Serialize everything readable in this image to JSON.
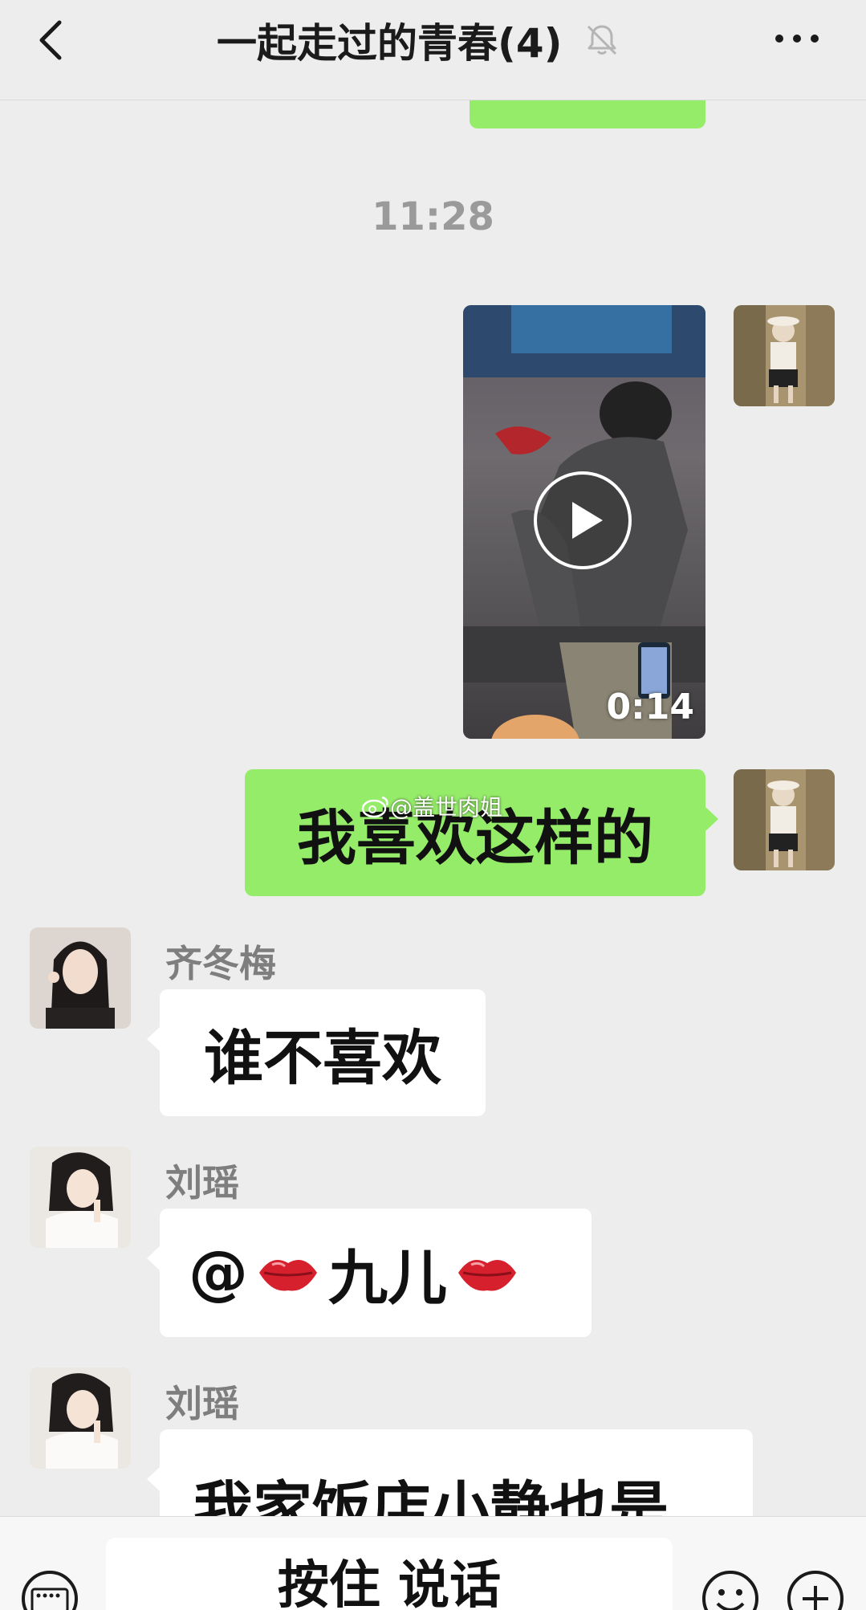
{
  "header": {
    "title": "一起走过的青春(4)",
    "back_icon": "chevron-left-icon",
    "mute_icon": "bell-slash-icon",
    "more_icon": "ellipsis-icon"
  },
  "chat": {
    "timestamp": "11:28",
    "video_message": {
      "duration": "0:14"
    },
    "my_text": "我喜欢这样的",
    "watermark": "@盖世肉姐",
    "messages": [
      {
        "sender": "齐冬梅",
        "text": "谁不喜欢"
      },
      {
        "sender": "刘瑶",
        "text_prefix": "@",
        "mention": "九儿",
        "emoji": "kiss-mark"
      },
      {
        "sender": "刘瑶",
        "text": "我家饭店小静也是"
      }
    ]
  },
  "input_bar": {
    "hold_to_talk": "按住 说话",
    "keyboard_icon": "keyboard-icon",
    "emoji_icon": "emoji-icon",
    "plus_icon": "plus-icon"
  },
  "colors": {
    "my_bubble": "#95ec69",
    "their_bubble": "#ffffff",
    "background": "#ededed"
  }
}
